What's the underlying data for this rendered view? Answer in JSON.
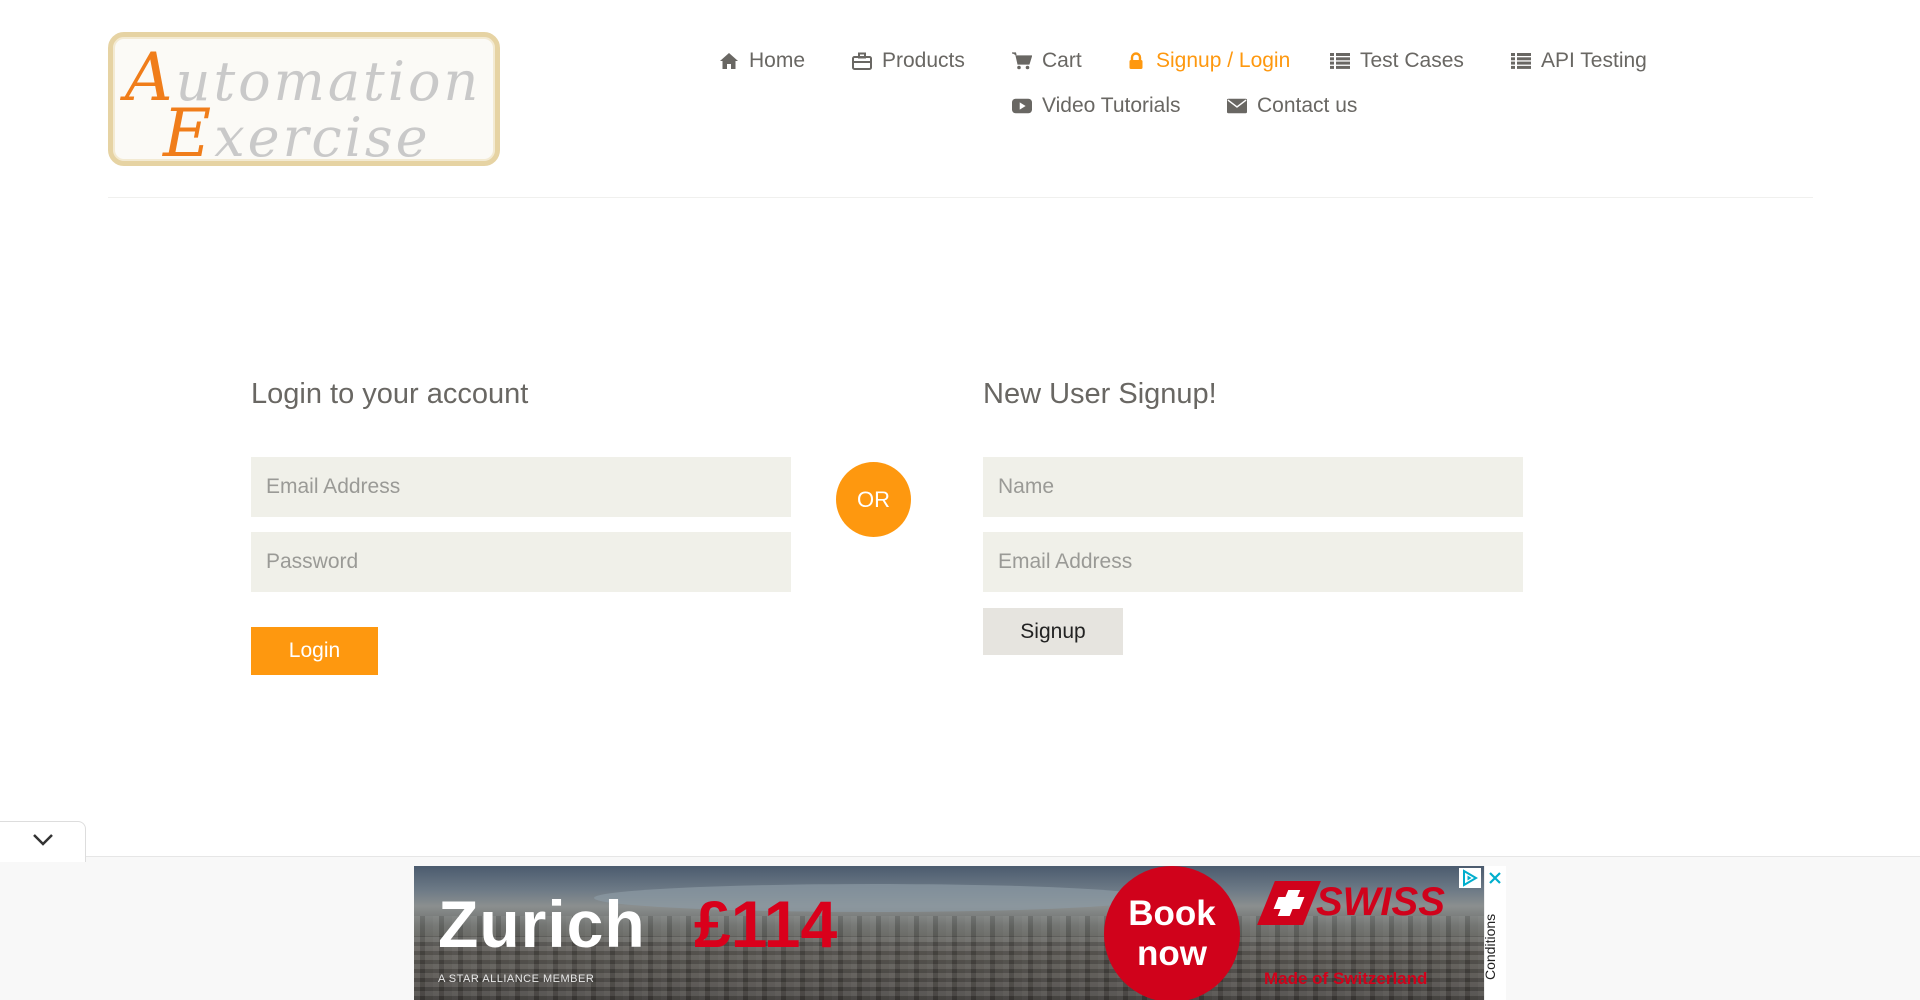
{
  "logo": {
    "line1_initial": "A",
    "line1_rest": "utomation",
    "line2_initial": "E",
    "line2_rest": "xercise"
  },
  "nav": [
    {
      "label": "Home",
      "icon": "home-icon"
    },
    {
      "label": "Products",
      "icon": "briefcase-icon"
    },
    {
      "label": "Cart",
      "icon": "cart-icon"
    },
    {
      "label": "Signup / Login",
      "icon": "lock-icon",
      "active": true
    },
    {
      "label": "Test Cases",
      "icon": "list-icon"
    },
    {
      "label": "API Testing",
      "icon": "list-icon"
    },
    {
      "label": "Video Tutorials",
      "icon": "youtube-play-icon"
    },
    {
      "label": "Contact us",
      "icon": "envelope-icon"
    }
  ],
  "login": {
    "title": "Login to your account",
    "email_placeholder": "Email Address",
    "password_placeholder": "Password",
    "button": "Login"
  },
  "or_label": "OR",
  "signup": {
    "title": "New User Signup!",
    "name_placeholder": "Name",
    "email_placeholder": "Email Address",
    "button": "Signup"
  },
  "ad": {
    "city": "Zurich",
    "price": "£114",
    "book_line1": "Book",
    "book_line2": "now",
    "brand": "SWISS",
    "tagline": "Made of Switzerland",
    "alliance": "A STAR ALLIANCE MEMBER",
    "conditions": "Conditions"
  },
  "colors": {
    "accent": "#fe980f",
    "text": "#696763",
    "field_bg": "#f0f0e9",
    "ad_red": "#d0021b"
  }
}
